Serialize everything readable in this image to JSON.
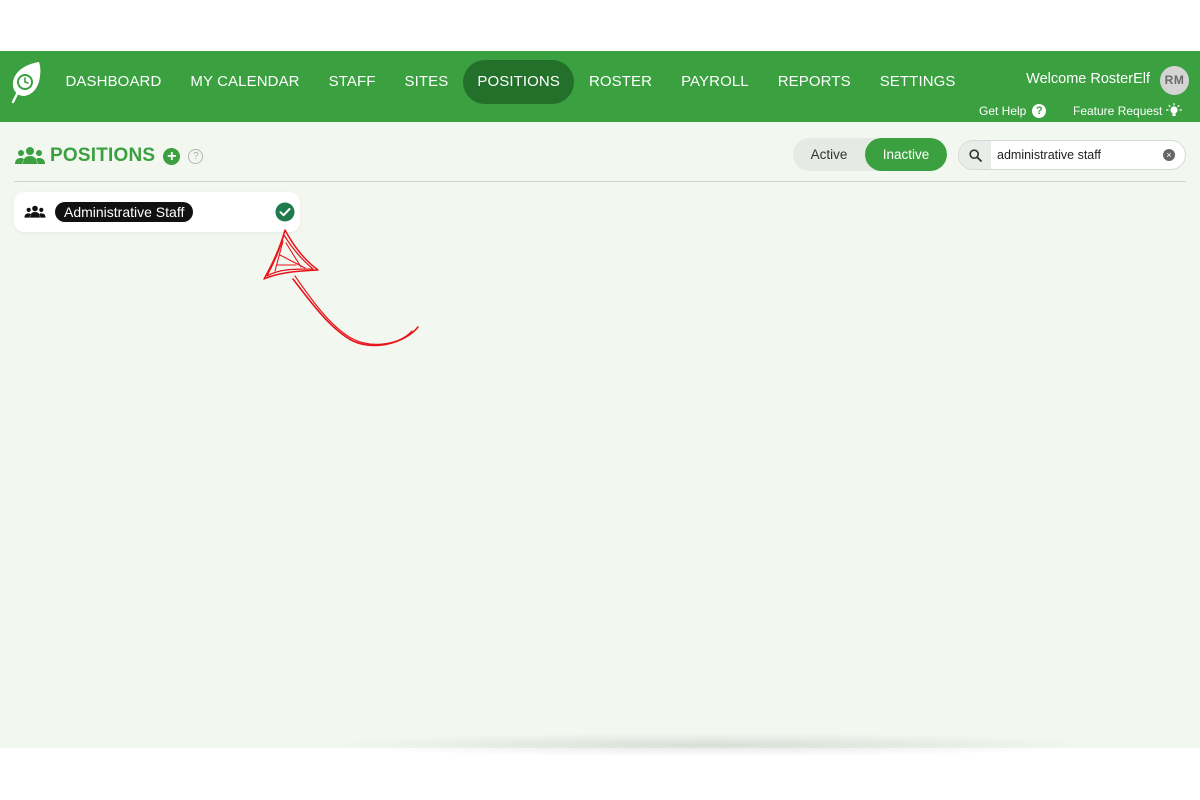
{
  "nav": {
    "items": [
      {
        "label": "DASHBOARD"
      },
      {
        "label": "MY CALENDAR"
      },
      {
        "label": "STAFF"
      },
      {
        "label": "SITES"
      },
      {
        "label": "POSITIONS"
      },
      {
        "label": "ROSTER"
      },
      {
        "label": "PAYROLL"
      },
      {
        "label": "REPORTS"
      },
      {
        "label": "SETTINGS"
      }
    ],
    "active": "POSITIONS"
  },
  "user": {
    "welcome": "Welcome RosterElf",
    "initials": "RM"
  },
  "header_links": {
    "help": "Get Help",
    "help_glyph": "?",
    "feature": "Feature Request"
  },
  "page": {
    "title": "POSITIONS",
    "add_glyph": "+",
    "info_glyph": "?"
  },
  "filter": {
    "active_label": "Active",
    "inactive_label": "Inactive",
    "selected": "Inactive"
  },
  "search": {
    "value": "administrative staff",
    "clear_glyph": "×"
  },
  "positions": [
    {
      "name": "Administrative Staff",
      "selected": true
    }
  ],
  "colors": {
    "brand_green": "#3aa040",
    "active_nav": "#23702b",
    "content_bg": "#f2f7f0",
    "check_green": "#1f7a4d",
    "annotation_red": "#e8141a"
  },
  "icons": {
    "logo": "leaf-clock-logo",
    "page": "users-icon",
    "search": "search-icon",
    "feature": "lightbulb-icon",
    "check": "check-circle-icon"
  }
}
